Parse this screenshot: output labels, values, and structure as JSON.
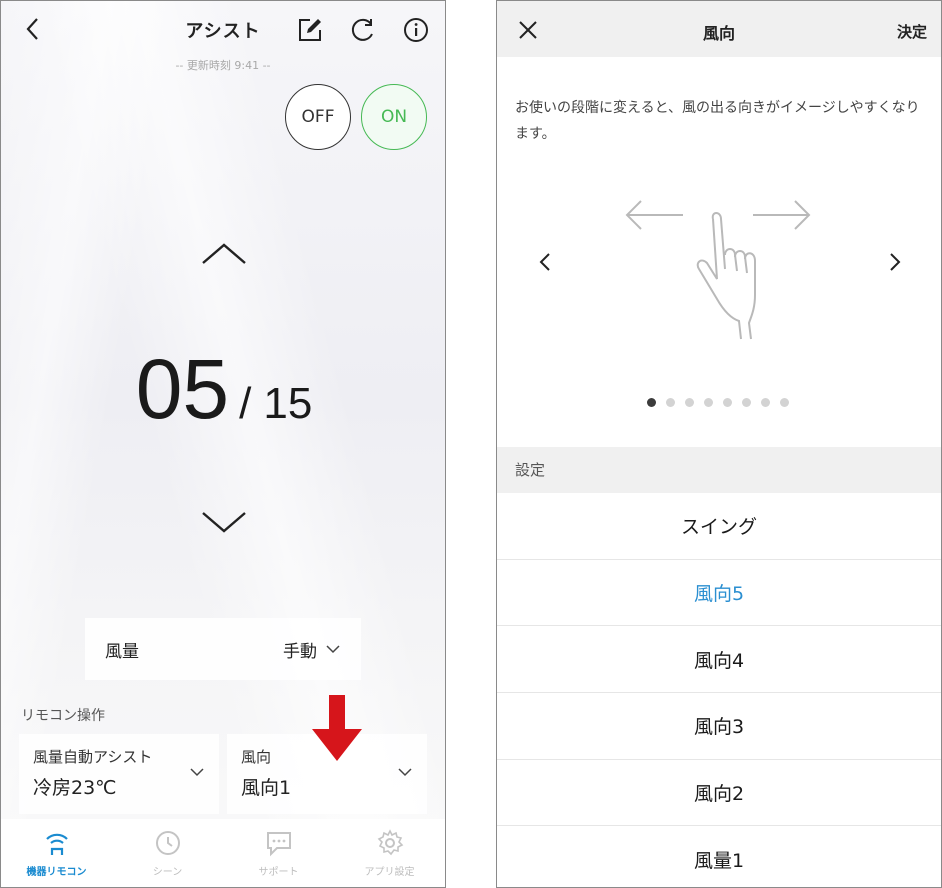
{
  "left": {
    "header": {
      "title": "アシスト",
      "back_icon": "chevron-left-icon",
      "edit_icon": "edit-icon",
      "refresh_icon": "refresh-icon",
      "info_icon": "info-icon"
    },
    "update_text": "-- 更新時刻 9:41 --",
    "power": {
      "off_label": "OFF",
      "on_label": "ON",
      "on_color": "#46b954"
    },
    "counter": {
      "current": "05",
      "separator": "/",
      "total": "15"
    },
    "wind_volume": {
      "label": "風量",
      "value": "手動"
    },
    "remote_section_label": "リモコン操作",
    "cards": [
      {
        "title": "風量自動アシスト",
        "value": "冷房23℃"
      },
      {
        "title": "風向",
        "value": "風向1"
      }
    ],
    "annotation_color": "#d6151b",
    "tabs": [
      {
        "label": "機器リモコン",
        "icon": "remote-wifi-icon",
        "active": true
      },
      {
        "label": "シーン",
        "icon": "clock-icon",
        "active": false
      },
      {
        "label": "サポート",
        "icon": "chat-icon",
        "active": false
      },
      {
        "label": "アプリ設定",
        "icon": "gear-icon",
        "active": false
      }
    ],
    "accent_color": "#1a8bd0"
  },
  "right": {
    "header": {
      "title": "風向",
      "done_label": "決定",
      "close_icon": "close-icon"
    },
    "description": "お使いの段階に変えると、風の出る向きがイメージしやすくなります。",
    "carousel": {
      "illustration": "swipe-hand-icon",
      "page_count": 8,
      "active_index": 0
    },
    "settings_label": "設定",
    "options": [
      "スイング",
      "風向5",
      "風向4",
      "風向3",
      "風向2",
      "風量1"
    ],
    "selected_option": "風向5",
    "selected_color": "#2b8fd1"
  }
}
